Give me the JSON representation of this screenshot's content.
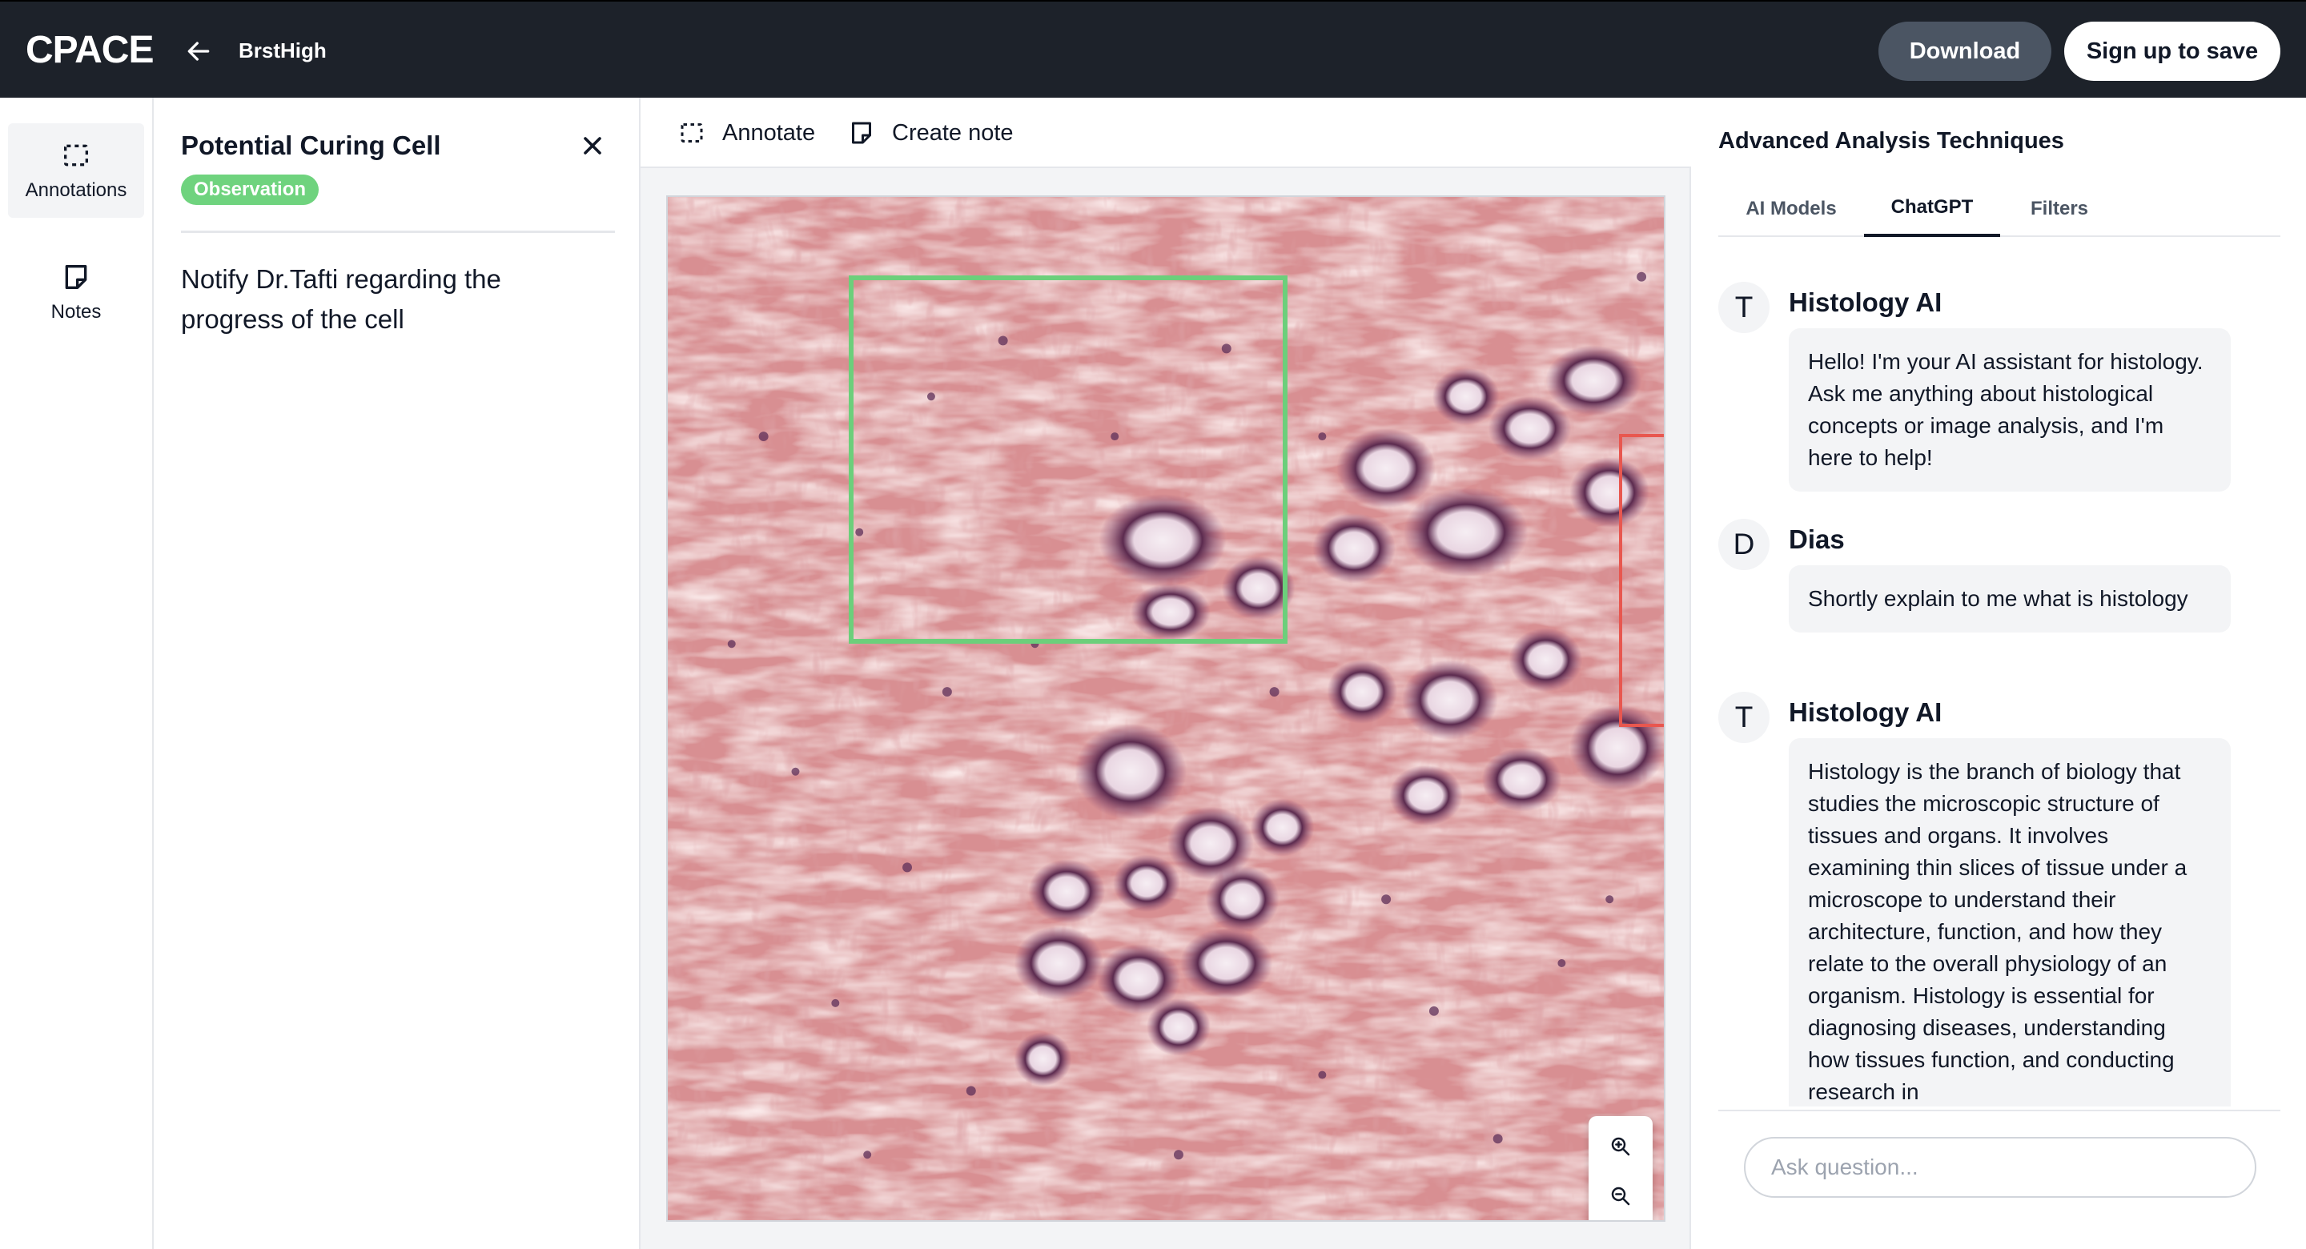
{
  "app": {
    "logo": "CPACE",
    "breadcrumb": "BrstHigh"
  },
  "header": {
    "download_label": "Download",
    "signup_label": "Sign up to save"
  },
  "rail": {
    "items": [
      {
        "label": "Annotations",
        "icon": "annotation-icon"
      },
      {
        "label": "Notes",
        "icon": "note-icon"
      }
    ]
  },
  "detail": {
    "title": "Potential Curing Cell",
    "badge": "Observation",
    "badge_color": "#6fd37e",
    "body": "Notify Dr.Tafti regarding the progress of the cell"
  },
  "viewer": {
    "tools": [
      {
        "label": "Annotate",
        "icon": "annotate-icon"
      },
      {
        "label": "Create note",
        "icon": "note-icon"
      }
    ],
    "annotation_colors": {
      "green": "#6ccf7b",
      "red": "#e8574f"
    },
    "zoom_controls": [
      "zoom-in-icon",
      "zoom-out-icon",
      "reset-icon"
    ]
  },
  "side": {
    "title": "Advanced Analysis Techniques",
    "tabs": [
      {
        "label": "AI Models"
      },
      {
        "label": "ChatGPT",
        "active": true
      },
      {
        "label": "Filters"
      }
    ],
    "messages": [
      {
        "initial": "T",
        "sender": "Histology AI",
        "text": "Hello! I'm your AI assistant for histology. Ask me anything about histological concepts or image analysis, and I'm here to help!"
      },
      {
        "initial": "D",
        "sender": "Dias",
        "text": "Shortly explain to me what is histology"
      },
      {
        "initial": "T",
        "sender": "Histology AI",
        "text": "Histology is the branch of biology that studies the microscopic structure of tissues and organs. It involves examining thin slices of tissue under a microscope to understand their architecture, function, and how they relate to the overall physiology of an organism. Histology is essential for diagnosing diseases, understanding how tissues function, and conducting research in"
      }
    ],
    "ask_placeholder": "Ask question..."
  }
}
